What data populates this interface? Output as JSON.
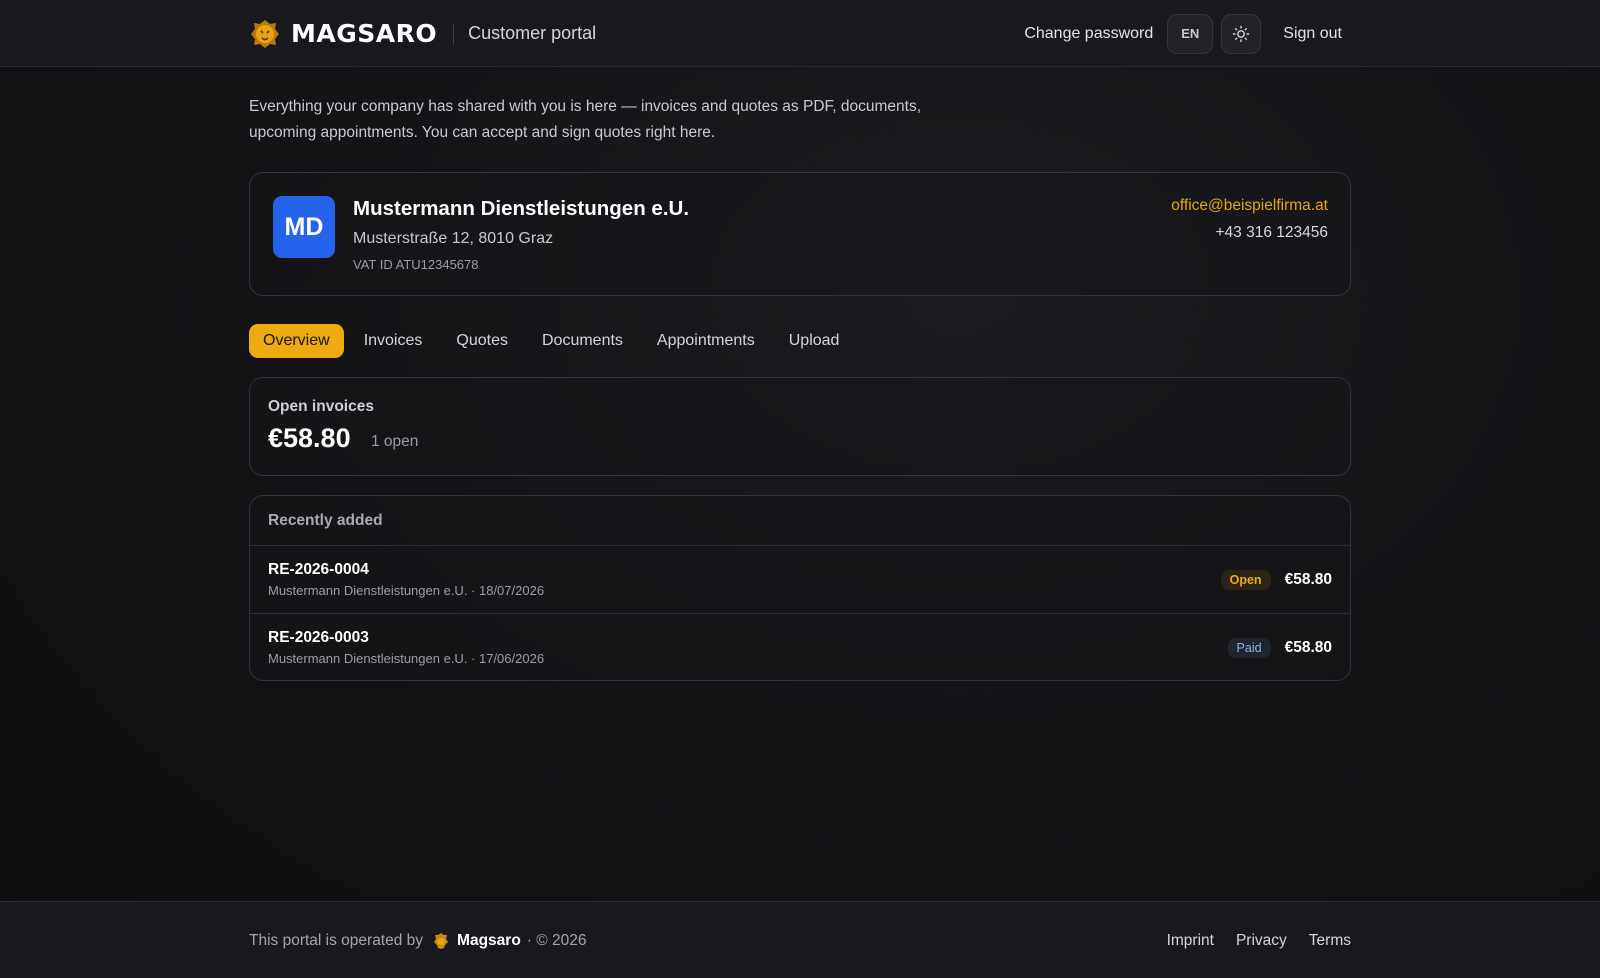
{
  "header": {
    "brand_name": "MAGSARO",
    "portal_label": "Customer portal",
    "change_password": "Change password",
    "language": "EN",
    "sign_out": "Sign out"
  },
  "intro": "Everything your company has shared with you is here — invoices and quotes as PDF, documents, upcoming appointments. You can accept and sign quotes right here.",
  "company": {
    "initials": "MD",
    "name": "Mustermann Dienstleistungen e.U.",
    "address": "Musterstraße 12, 8010 Graz",
    "vat": "VAT ID ATU12345678",
    "email": "office@beispielfirma.at",
    "phone": "+43 316 123456",
    "avatar_color": "#2563eb"
  },
  "tabs": [
    {
      "label": "Overview",
      "active": true
    },
    {
      "label": "Invoices",
      "active": false
    },
    {
      "label": "Quotes",
      "active": false
    },
    {
      "label": "Documents",
      "active": false
    },
    {
      "label": "Appointments",
      "active": false
    },
    {
      "label": "Upload",
      "active": false
    }
  ],
  "open_invoices": {
    "label": "Open invoices",
    "amount": "€58.80",
    "count": "1 open"
  },
  "recent": {
    "title": "Recently added",
    "items": [
      {
        "number": "RE-2026-0004",
        "meta": "Mustermann Dienstleistungen e.U. · 18/07/2026",
        "status": "Open",
        "amount": "€58.80"
      },
      {
        "number": "RE-2026-0003",
        "meta": "Mustermann Dienstleistungen e.U. · 17/06/2026",
        "status": "Paid",
        "amount": "€58.80"
      }
    ]
  },
  "footer": {
    "operated_by": "This portal is operated by",
    "brand": "Magsaro",
    "copyright": "· © 2026",
    "links": [
      "Imprint",
      "Privacy",
      "Terms"
    ]
  },
  "colors": {
    "accent": "#eeaa12",
    "link": "#e8a317",
    "background": "#141417"
  },
  "icons": {
    "logo": "lion-head-icon",
    "theme": "sun-icon"
  }
}
